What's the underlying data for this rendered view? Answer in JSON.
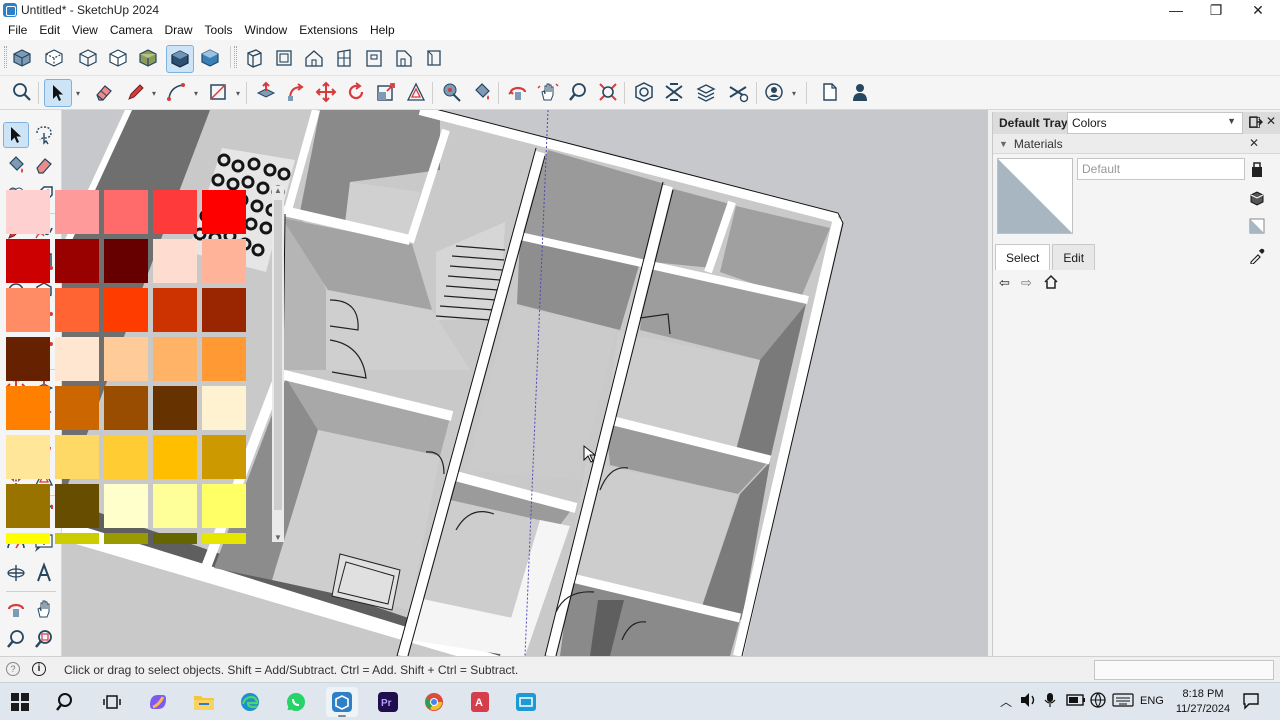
{
  "window": {
    "title": "Untitled* - SketchUp 2024",
    "minimize": "—",
    "maximize": "❐",
    "close": "✕"
  },
  "menu": [
    "File",
    "Edit",
    "View",
    "Camera",
    "Draw",
    "Tools",
    "Window",
    "Extensions",
    "Help"
  ],
  "tray": {
    "title": "Default Tray",
    "panel": "Materials",
    "material_name_placeholder": "Default",
    "tabs": [
      "Select",
      "Edit"
    ],
    "library": "Colors",
    "preview_color": "#a8b6c2",
    "swatches": [
      [
        "#ffd0d0",
        "#ff9a9a",
        "#ff6a6a",
        "#ff3a3a",
        "#ff0000"
      ],
      [
        "#cc0000",
        "#990000",
        "#660000",
        "#ffdcd0",
        "#ffb49a"
      ],
      [
        "#ff8c64",
        "#ff6432",
        "#ff3c00",
        "#cc3300",
        "#992600"
      ],
      [
        "#662200",
        "#ffe6d0",
        "#ffcc99",
        "#ffb366",
        "#ff9933"
      ],
      [
        "#ff8000",
        "#cc6600",
        "#994d00",
        "#663300",
        "#fff2d0"
      ],
      [
        "#ffe699",
        "#ffd966",
        "#ffcc33",
        "#ffbf00",
        "#cc9900"
      ],
      [
        "#997300",
        "#664d00",
        "#ffffcc",
        "#ffff99",
        "#ffff66"
      ],
      [
        "#ffff00",
        "#cccc00",
        "#999900",
        "#666600",
        "#e6e600"
      ]
    ]
  },
  "status": {
    "hint": "Click or drag to select objects. Shift = Add/Subtract. Ctrl = Add. Shift + Ctrl = Subtract."
  },
  "taskbar": {
    "language": "ENG",
    "time": "8:18 PM",
    "date": "11/27/2024"
  }
}
